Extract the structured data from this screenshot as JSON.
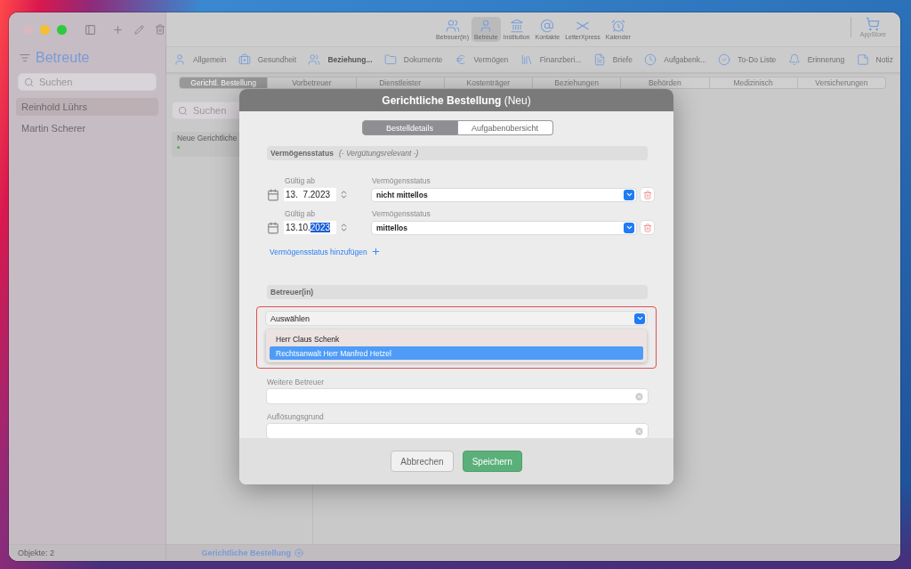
{
  "sidebar": {
    "title": "Betreute",
    "search_placeholder": "Suchen",
    "items": [
      {
        "label": "Reinhold Lührs",
        "selected": true
      },
      {
        "label": "Martin Scherer",
        "selected": false
      }
    ],
    "footer": "Objekte: 2"
  },
  "toolbar": {
    "items": [
      {
        "label": "Betreuer(in)",
        "selected": false
      },
      {
        "label": "Betreute",
        "selected": true
      },
      {
        "label": "Institution",
        "selected": false
      },
      {
        "label": "Kontakte",
        "selected": false
      },
      {
        "label": "LetterXpress",
        "selected": false
      },
      {
        "label": "Kalender",
        "selected": false
      }
    ],
    "store": "AppStore"
  },
  "nav": [
    {
      "label": "Allgemein",
      "selected": false
    },
    {
      "label": "Gesundheit",
      "selected": false
    },
    {
      "label": "Beziehung...",
      "selected": true
    },
    {
      "label": "Dokumente",
      "selected": false
    },
    {
      "label": "Vermögen",
      "selected": false
    },
    {
      "label": "Finanzberi...",
      "selected": false
    },
    {
      "label": "Briefe",
      "selected": false
    },
    {
      "label": "Aufgabenk...",
      "selected": false
    },
    {
      "label": "To-Do Liste",
      "selected": false
    },
    {
      "label": "Erinnerung",
      "selected": false
    },
    {
      "label": "Notiz",
      "selected": false
    }
  ],
  "segments": [
    {
      "label": "Gerichtl. Bestellung",
      "selected": true
    },
    {
      "label": "Vorbetreuer",
      "selected": false
    },
    {
      "label": "Dienstleister",
      "selected": false
    },
    {
      "label": "Kostenträger",
      "selected": false
    },
    {
      "label": "Beziehungen",
      "selected": false
    },
    {
      "label": "Behörden",
      "selected": false
    },
    {
      "label": "Medizinisch",
      "selected": false
    },
    {
      "label": "Versicherungen",
      "selected": false
    }
  ],
  "list": {
    "search_placeholder": "Suchen",
    "items": [
      {
        "title": "Neue Gerichtliche",
        "color": "#4caf50"
      }
    ],
    "footer_link": "Gerichtliche Bestellung"
  },
  "dialog": {
    "title": "**Gerichtliche Bestellung** (Neu)",
    "tabs": [
      {
        "label": "Bestelldetails",
        "selected": true
      },
      {
        "label": "Aufgabenübersicht",
        "selected": false
      }
    ],
    "assets": {
      "title": "Vermögensstatus",
      "note": "(- Vergütungsrelevant -)",
      "rows": [
        {
          "date_label": "Gültig ab",
          "date": [
            {
              "text": "13.  7.2023",
              "selected": false
            }
          ],
          "status_label": "Vermögensstatus",
          "status": "nicht mittellos"
        },
        {
          "date_label": "Gültig ab",
          "date": [
            {
              "text": "13.10.",
              "selected": false
            },
            {
              "text": "2023",
              "selected": true
            }
          ],
          "status_label": "Vermögensstatus",
          "status": "mittellos"
        }
      ],
      "add_link": "Vermögensstatus hinzufügen"
    },
    "guardian": {
      "title": "Betreuer(in)",
      "select": "Auswählen",
      "invalid": true,
      "options": [
        {
          "label": "Herr Claus Schenk",
          "selected": false
        },
        {
          "label": "Rechtsanwalt Herr Manfred Hetzel",
          "selected": true
        }
      ]
    },
    "fields": [
      {
        "label": "Weitere Betreuer"
      },
      {
        "label": "Auflösungsgrund"
      }
    ],
    "buttons": [
      {
        "label": "Abbrechen",
        "kind": "secondary"
      },
      {
        "label": "Speichern",
        "kind": "primary"
      }
    ]
  }
}
